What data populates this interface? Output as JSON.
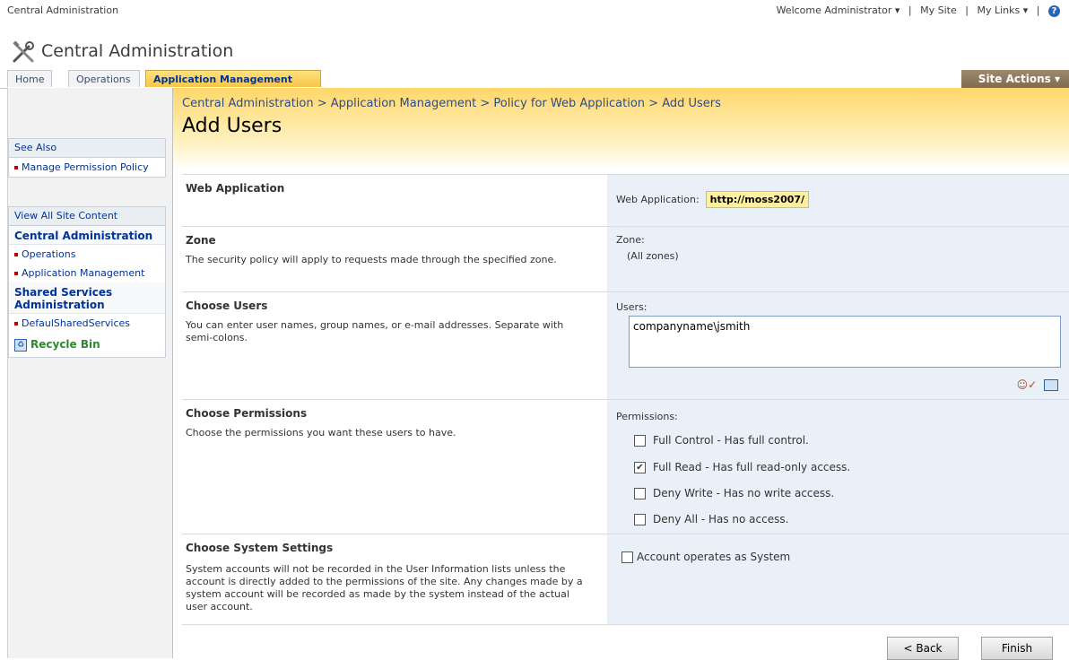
{
  "topbar": {
    "left_title": "Central Administration",
    "welcome": "Welcome Administrator",
    "my_site": "My Site",
    "my_links": "My Links"
  },
  "site": {
    "title": "Central Administration"
  },
  "tabs": [
    {
      "label": "Home"
    },
    {
      "label": "Operations"
    },
    {
      "label": "Application Management"
    }
  ],
  "site_actions": "Site Actions",
  "leftnav": {
    "see_also": "See Also",
    "see_also_item": "Manage Permission Policy",
    "view_all": "View All Site Content",
    "section1": "Central Administration",
    "section1_items": [
      "Operations",
      "Application Management"
    ],
    "section2": "Shared Services Administration",
    "section2_items": [
      "DefaulSharedServices"
    ],
    "recycle": "Recycle Bin"
  },
  "breadcrumb": {
    "c1": "Central Administration",
    "c2": "Application Management",
    "c3": "Policy for Web Application",
    "c4": "Add Users",
    "separator": ">"
  },
  "page_title": "Add Users",
  "sections": {
    "webapp": {
      "title": "Web Application",
      "label": "Web Application:",
      "value": "http://moss2007/"
    },
    "zone": {
      "title": "Zone",
      "desc": "The security policy will apply to requests made through the specified zone.",
      "label": "Zone:",
      "value": "(All zones)"
    },
    "users": {
      "title": "Choose Users",
      "desc": "You can enter user names, group names, or e-mail addresses. Separate with semi-colons.",
      "label": "Users:",
      "value": "companyname\\jsmith"
    },
    "permissions": {
      "title": "Choose Permissions",
      "desc": "Choose the permissions you want these users to have.",
      "label": "Permissions:",
      "options": [
        {
          "label": "Full Control - Has full control.",
          "checked": false
        },
        {
          "label": "Full Read - Has full read-only access.",
          "checked": true
        },
        {
          "label": "Deny Write - Has no write access.",
          "checked": false
        },
        {
          "label": "Deny All - Has no access.",
          "checked": false
        }
      ]
    },
    "system": {
      "title": "Choose System Settings",
      "desc": "System accounts will not be recorded in the User Information lists unless the account is directly added to the permissions of the site.  Any changes made by a system account will be recorded as made by the system instead of the actual user account.",
      "option": "Account operates as System",
      "checked": false
    }
  },
  "buttons": {
    "back": "< Back",
    "finish": "Finish"
  }
}
